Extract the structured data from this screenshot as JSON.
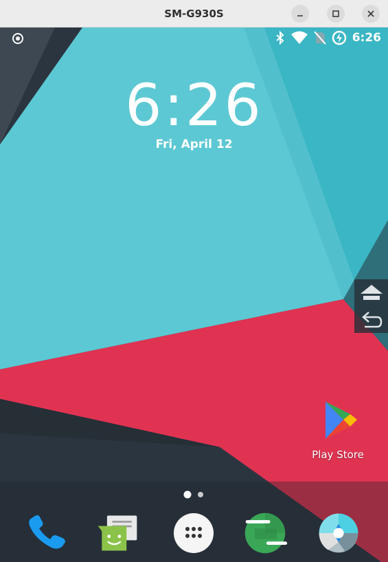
{
  "window": {
    "title": "SM-G930S",
    "controls": [
      "minimize-icon",
      "maximize-icon",
      "close-icon"
    ]
  },
  "statusbar": {
    "left_icons": [
      "screen-record-icon"
    ],
    "right_icons": [
      "bluetooth-icon",
      "wifi-icon",
      "no-sim-icon",
      "battery-charging-icon"
    ],
    "time": "6:26"
  },
  "lockscreen": {
    "clock": "6:26",
    "date": "Fri, April 12"
  },
  "side_panel": {
    "buttons": [
      "home-icon",
      "back-icon"
    ]
  },
  "desktop": {
    "apps": [
      {
        "label": "Play Store",
        "icon": "play-store-icon"
      }
    ],
    "page_indicator": {
      "pages": 2,
      "current": 1
    }
  },
  "dock": {
    "apps": [
      "phone-icon",
      "messaging-icon",
      "app-drawer-icon",
      "hangouts-icon",
      "camera-icon"
    ]
  },
  "colors": {
    "teal": "#5cc8d3",
    "teal_dark": "#3ab6c4",
    "red": "#e03352",
    "dark": "#2b3540"
  }
}
